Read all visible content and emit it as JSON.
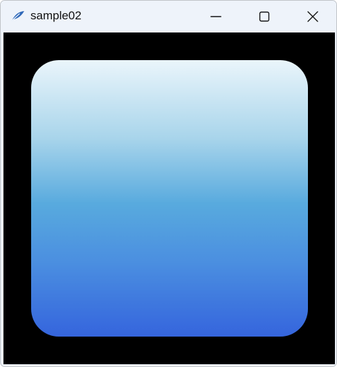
{
  "window": {
    "title": "sample02",
    "app_icon": "feather-quill-icon"
  },
  "caption_buttons": {
    "minimize_icon": "minimize-icon",
    "maximize_icon": "maximize-icon",
    "close_icon": "close-icon"
  },
  "canvas": {
    "background_color": "#000000",
    "shape": "rounded-square",
    "gradient_colors": [
      "#eaf5fb",
      "#a9d5eb",
      "#58aade",
      "#4b8fe0",
      "#3565dd"
    ]
  }
}
